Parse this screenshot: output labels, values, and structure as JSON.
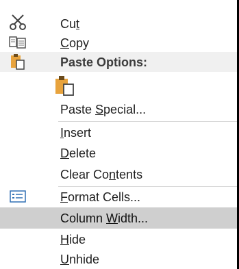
{
  "menu": {
    "items": [
      {
        "pre": "Cu",
        "acc": "t",
        "post": "",
        "icon": "scissors-icon"
      },
      {
        "pre": "",
        "acc": "C",
        "post": "opy",
        "icon": "copy-icon"
      },
      {
        "pre": "Paste Options:",
        "acc": "",
        "post": "",
        "icon": "paste-icon"
      },
      {
        "pre": "",
        "acc": "",
        "post": "",
        "icon": "paste-option-icon"
      },
      {
        "pre": "Paste ",
        "acc": "S",
        "post": "pecial...",
        "icon": ""
      },
      {
        "pre": "",
        "acc": "I",
        "post": "nsert",
        "icon": ""
      },
      {
        "pre": "",
        "acc": "D",
        "post": "elete",
        "icon": ""
      },
      {
        "pre": "Clear Co",
        "acc": "n",
        "post": "tents",
        "icon": ""
      },
      {
        "pre": "",
        "acc": "F",
        "post": "ormat Cells...",
        "icon": "format-cells-icon"
      },
      {
        "pre": "Column ",
        "acc": "W",
        "post": "idth...",
        "icon": ""
      },
      {
        "pre": "",
        "acc": "H",
        "post": "ide",
        "icon": ""
      },
      {
        "pre": "",
        "acc": "U",
        "post": "nhide",
        "icon": ""
      }
    ]
  },
  "colors": {
    "highlight": "#cfcfcf",
    "header_bg": "#f0f0f0",
    "paste_orange": "#e8a33d"
  }
}
